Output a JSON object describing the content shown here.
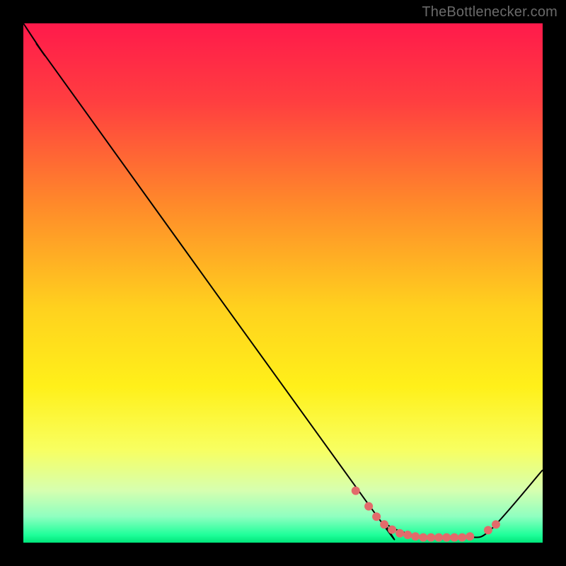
{
  "attribution": "TheBottlenecker.com",
  "chart_data": {
    "type": "line",
    "title": "",
    "xlabel": "",
    "ylabel": "",
    "xlim": [
      0,
      100
    ],
    "ylim": [
      0,
      100
    ],
    "gradient_stops": [
      {
        "offset": 0.0,
        "color": "#ff1a4b"
      },
      {
        "offset": 0.15,
        "color": "#ff3e40"
      },
      {
        "offset": 0.35,
        "color": "#ff8a2a"
      },
      {
        "offset": 0.55,
        "color": "#ffd21e"
      },
      {
        "offset": 0.7,
        "color": "#fff01a"
      },
      {
        "offset": 0.82,
        "color": "#f8ff60"
      },
      {
        "offset": 0.9,
        "color": "#d6ffb0"
      },
      {
        "offset": 0.95,
        "color": "#8effc0"
      },
      {
        "offset": 0.985,
        "color": "#1fff9a"
      },
      {
        "offset": 1.0,
        "color": "#00e57a"
      }
    ],
    "series": [
      {
        "name": "curve",
        "points": [
          {
            "x": 0.0,
            "y": 100.0
          },
          {
            "x": 4.0,
            "y": 94.0
          },
          {
            "x": 8.0,
            "y": 88.5
          },
          {
            "x": 66.0,
            "y": 8.0
          },
          {
            "x": 70.0,
            "y": 3.5
          },
          {
            "x": 75.0,
            "y": 1.5
          },
          {
            "x": 80.0,
            "y": 1.0
          },
          {
            "x": 86.0,
            "y": 1.0
          },
          {
            "x": 90.0,
            "y": 2.5
          },
          {
            "x": 100.0,
            "y": 14.0
          }
        ]
      }
    ],
    "markers": [
      {
        "x": 64.0,
        "y": 10.0
      },
      {
        "x": 66.5,
        "y": 7.0
      },
      {
        "x": 68.0,
        "y": 5.0
      },
      {
        "x": 69.5,
        "y": 3.5
      },
      {
        "x": 71.0,
        "y": 2.5
      },
      {
        "x": 72.5,
        "y": 1.8
      },
      {
        "x": 74.0,
        "y": 1.5
      },
      {
        "x": 75.5,
        "y": 1.2
      },
      {
        "x": 77.0,
        "y": 1.0
      },
      {
        "x": 78.5,
        "y": 1.0
      },
      {
        "x": 80.0,
        "y": 1.0
      },
      {
        "x": 81.5,
        "y": 1.0
      },
      {
        "x": 83.0,
        "y": 1.0
      },
      {
        "x": 84.5,
        "y": 1.0
      },
      {
        "x": 86.0,
        "y": 1.2
      },
      {
        "x": 89.5,
        "y": 2.4
      },
      {
        "x": 91.0,
        "y": 3.5
      }
    ],
    "marker_style": {
      "color": "#e26b6b",
      "radius": 6
    },
    "line_style": {
      "color": "#000000",
      "width": 2
    }
  }
}
